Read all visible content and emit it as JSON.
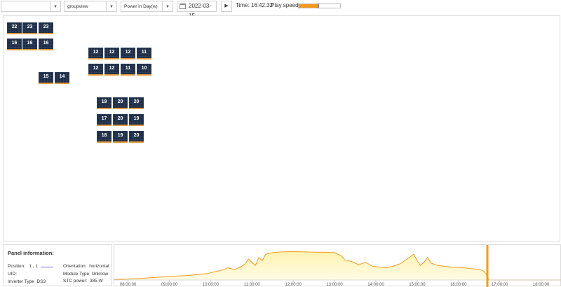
{
  "toolbar": {
    "select1": {
      "value": ""
    },
    "view_select": {
      "value": "groupview"
    },
    "metric_select": {
      "value": "Power in Day(w)"
    },
    "date": "2022-03-15",
    "time_label": "Time: 16:42:32",
    "speed_label": "Play speed:",
    "play_speed_fraction": 0.45,
    "accent": "#f39a1e"
  },
  "panels": [
    {
      "value": "22"
    },
    {
      "value": "23"
    },
    {
      "value": "23"
    },
    {
      "value": "16"
    },
    {
      "value": "16"
    },
    {
      "value": "16"
    },
    {
      "value": "12"
    },
    {
      "value": "12"
    },
    {
      "value": "12"
    },
    {
      "value": "11"
    },
    {
      "value": "12"
    },
    {
      "value": "12"
    },
    {
      "value": "11"
    },
    {
      "value": "10"
    },
    {
      "value": "15"
    },
    {
      "value": "14"
    },
    {
      "value": "19"
    },
    {
      "value": "20"
    },
    {
      "value": "20"
    },
    {
      "value": "17"
    },
    {
      "value": "20"
    },
    {
      "value": "19"
    },
    {
      "value": "18"
    },
    {
      "value": "19"
    },
    {
      "value": "20"
    }
  ],
  "panel_info": {
    "title": "Panel information:",
    "position_label": "Position:",
    "position_value": "1 , 1",
    "uid_label": "UID:",
    "uid_value": "",
    "inverter_label": "Inverter Type",
    "inverter_value": "DS3",
    "orientation_label": "Orientation:",
    "orientation_value": "horizontal",
    "module_label": "Module Type",
    "module_value": "Unknow",
    "stc_label": "STC power:",
    "stc_value": "385 W"
  },
  "chart_data": {
    "type": "area",
    "x_ticks": [
      "08:00:00",
      "09:00:00",
      "10:00:00",
      "11:00:00",
      "12:00:00",
      "13:00:00",
      "14:00:00",
      "15:00:00",
      "16:00:00",
      "17:00:00",
      "18:00:00"
    ],
    "x": [
      "07:40",
      "07:55",
      "08:10",
      "08:25",
      "08:40",
      "08:55",
      "09:10",
      "09:25",
      "09:40",
      "09:55",
      "10:05",
      "10:15",
      "10:25",
      "10:35",
      "10:45",
      "10:50",
      "10:55",
      "11:00",
      "11:05",
      "11:10",
      "11:15",
      "11:20",
      "11:30",
      "11:45",
      "12:00",
      "12:15",
      "12:30",
      "12:45",
      "13:00",
      "13:10",
      "13:15",
      "13:25",
      "13:35",
      "13:45",
      "13:55",
      "14:05",
      "14:15",
      "14:25",
      "14:35",
      "14:45",
      "14:55",
      "15:00",
      "15:05",
      "15:10",
      "15:15",
      "15:20",
      "15:30",
      "15:40",
      "15:50",
      "16:00",
      "16:10",
      "16:20",
      "16:30",
      "16:35",
      "16:40",
      "16:42",
      "16:44",
      "16:50",
      "17:00",
      "17:30",
      "18:00",
      "18:30"
    ],
    "y": [
      0.3,
      0.5,
      0.8,
      1.2,
      1.6,
      2,
      2.4,
      2.8,
      3.3,
      4,
      5,
      6,
      7.5,
      6.5,
      8.5,
      10,
      13,
      11,
      9,
      14,
      12,
      16,
      17,
      17.5,
      17.6,
      17.5,
      17.3,
      17.2,
      17,
      15,
      12.5,
      11.5,
      9.5,
      11,
      8.5,
      8,
      7.5,
      8.5,
      10,
      13,
      16,
      12,
      9,
      11,
      14,
      10.5,
      9,
      8.5,
      8,
      7.8,
      7.5,
      7,
      6.5,
      6,
      4,
      2,
      0,
      0,
      0,
      0,
      0,
      0
    ],
    "y_max": 20,
    "x_range": [
      "07:40",
      "18:30"
    ],
    "cursor_time": "16:42",
    "line_color": "#f39a1e",
    "fill_color": "#fff3b0",
    "grid": false
  }
}
